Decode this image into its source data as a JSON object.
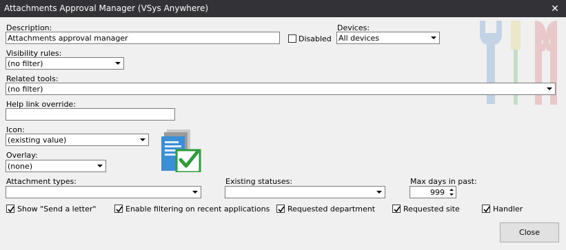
{
  "window": {
    "title": "Attachments Approval Manager (VSys Anywhere)",
    "close_glyph": "✕"
  },
  "form": {
    "description": {
      "label": "Description:",
      "value": "Attachments approval manager"
    },
    "disabled": {
      "label": "Disabled",
      "checked": false
    },
    "devices": {
      "label": "Devices:",
      "value": "All devices"
    },
    "visibility_rules": {
      "label": "Visibility rules:",
      "value": "(no filter)"
    },
    "related_tools": {
      "label": "Related tools:",
      "value": "(no filter)"
    },
    "help_link": {
      "label": "Help link override:",
      "value": ""
    },
    "icon": {
      "label": "Icon:",
      "value": "(existing value)",
      "preview_icon": "document-check-icon"
    },
    "overlay": {
      "label": "Overlay:",
      "value": "(none)"
    },
    "attachment_types": {
      "label": "Attachment types:",
      "value": ""
    },
    "existing_statuses": {
      "label": "Existing statuses:",
      "value": ""
    },
    "max_days": {
      "label": "Max days in past:",
      "value": "999"
    }
  },
  "checkboxes": [
    {
      "label": "Show \"Send a letter\"",
      "checked": true
    },
    {
      "label": "Enable filtering on recent applications",
      "checked": true
    },
    {
      "label": "Requested department",
      "checked": true
    },
    {
      "label": "Requested site",
      "checked": true
    },
    {
      "label": "Handler",
      "checked": true
    }
  ],
  "buttons": {
    "close": "Close"
  },
  "colors": {
    "titlebar": "#333337",
    "background": "#f0f0f0",
    "check_green": "#2e9b3a",
    "doc_blue": "#3b8fd6"
  },
  "watermark": {
    "icon": "tools-watermark-icon"
  }
}
